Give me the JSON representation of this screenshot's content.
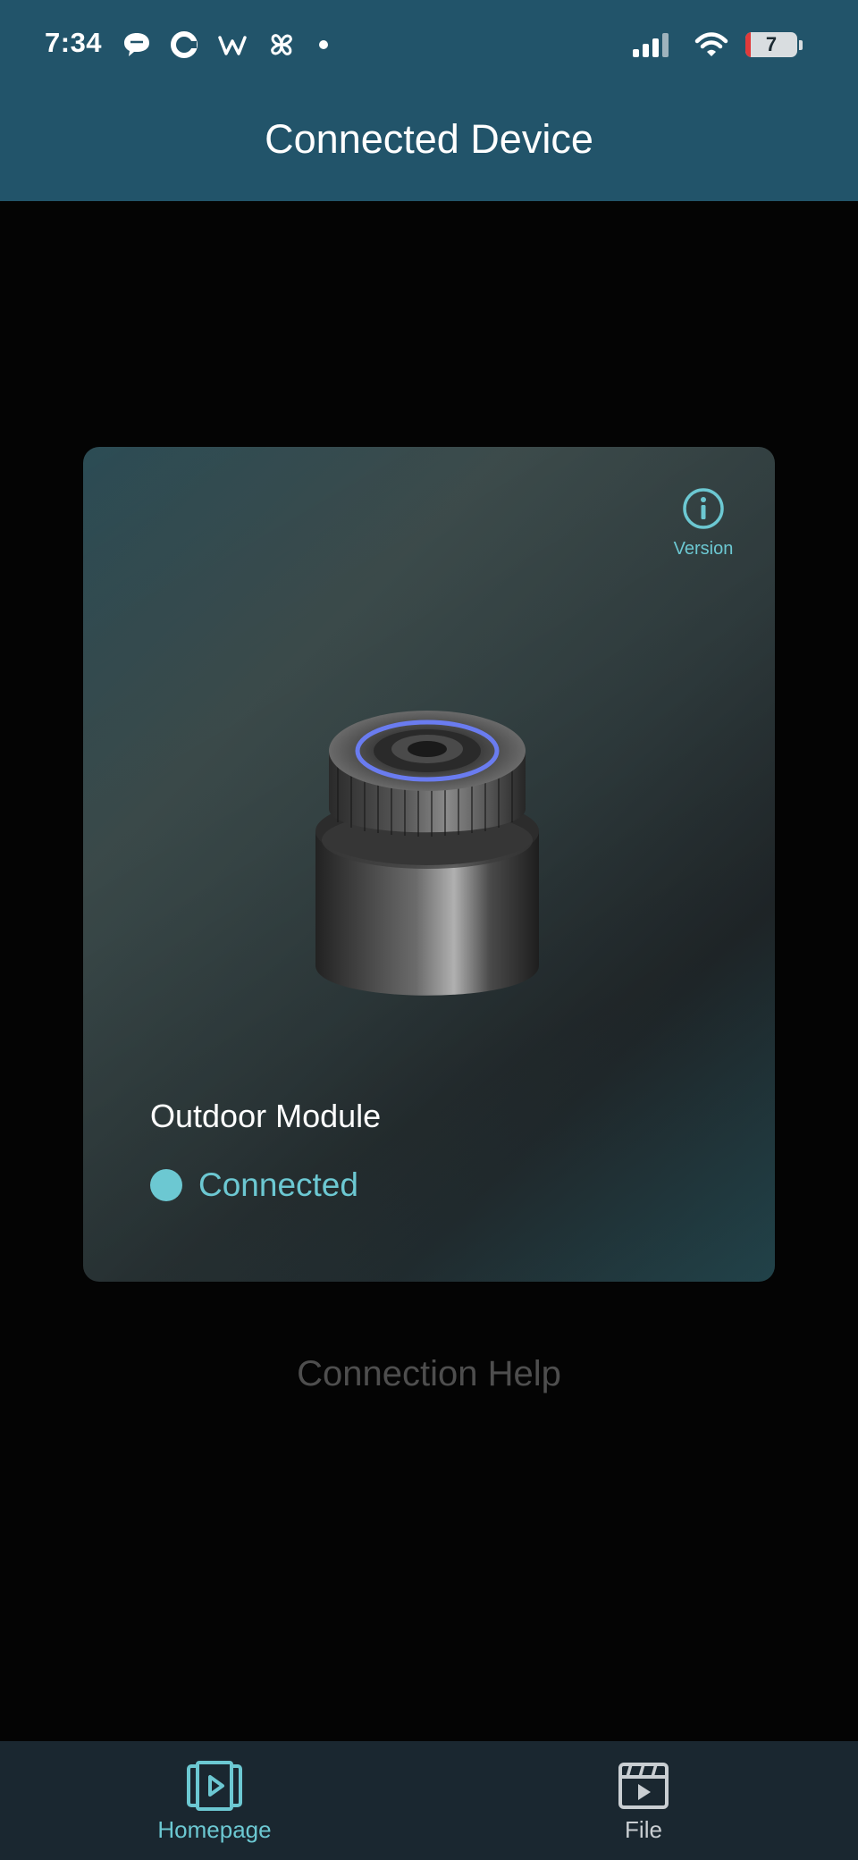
{
  "status_bar": {
    "time": "7:34",
    "notification_icons": [
      "chat-bubble-icon",
      "c-logo-icon",
      "w-logo-icon",
      "pinwheel-icon",
      "dot-icon"
    ],
    "battery_level": "7"
  },
  "header": {
    "title": "Connected Device"
  },
  "device_card": {
    "version_label": "Version",
    "device_name": "Outdoor Module",
    "status": "Connected",
    "status_color": "#6cc8d2"
  },
  "connection_help": "Connection Help",
  "bottom_nav": {
    "items": [
      {
        "label": "Homepage",
        "icon": "video-play-icon",
        "active": true
      },
      {
        "label": "File",
        "icon": "clapperboard-icon",
        "active": false
      }
    ]
  },
  "colors": {
    "header_bg": "#22546a",
    "accent": "#6cc8d2",
    "nav_bg": "#1a2730"
  }
}
